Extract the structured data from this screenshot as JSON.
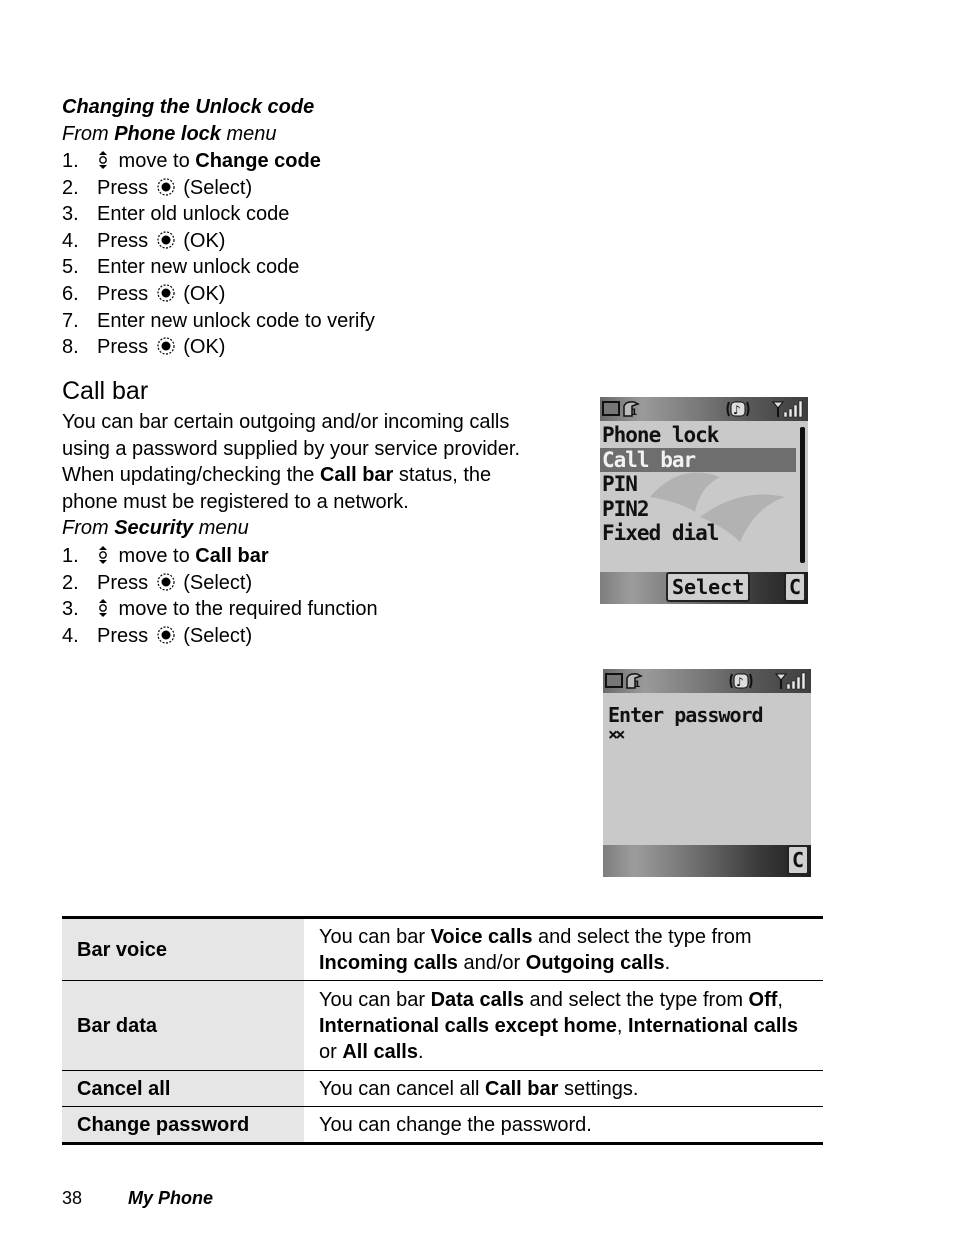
{
  "unlock_section": {
    "subheading": "Changing the Unlock code",
    "from_prefix": "From ",
    "from_menu": "Phone lock",
    "from_suffix": " menu",
    "steps": [
      {
        "num": "1.",
        "icon": "nav-key-icon",
        "pre": " move to ",
        "bold": "Change code",
        "post": ""
      },
      {
        "num": "2.",
        "icon": "select-key-icon",
        "pre": "Press ",
        "bold": "",
        "post": " (Select)"
      },
      {
        "num": "3.",
        "icon": "",
        "pre": "Enter old unlock code",
        "bold": "",
        "post": ""
      },
      {
        "num": "4.",
        "icon": "select-key-icon",
        "pre": "Press ",
        "bold": "",
        "post": " (OK)"
      },
      {
        "num": "5.",
        "icon": "",
        "pre": "Enter new unlock code",
        "bold": "",
        "post": ""
      },
      {
        "num": "6.",
        "icon": "select-key-icon",
        "pre": "Press ",
        "bold": "",
        "post": " (OK)"
      },
      {
        "num": "7.",
        "icon": "",
        "pre": "Enter new unlock code to verify",
        "bold": "",
        "post": ""
      },
      {
        "num": "8.",
        "icon": "select-key-icon",
        "pre": "Press ",
        "bold": "",
        "post": " (OK)"
      }
    ]
  },
  "callbar_section": {
    "heading": "Call bar",
    "intro_1": "You can bar certain outgoing and/or incoming calls",
    "intro_2": "using a password supplied by your service provider.",
    "intro_3_pre": "When updating/checking the ",
    "intro_3_bold": "Call bar",
    "intro_3_post": " status, the",
    "intro_4": "phone must be registered to a network.",
    "from_prefix": "From ",
    "from_menu": "Security",
    "from_suffix": " menu",
    "steps": [
      {
        "num": "1.",
        "icon": "nav-key-icon",
        "pre": " move to ",
        "bold": "Call bar",
        "post": ""
      },
      {
        "num": "2.",
        "icon": "select-key-icon",
        "pre": "Press ",
        "bold": "",
        "post": " (Select)"
      },
      {
        "num": "3.",
        "icon": "nav-key-icon",
        "pre": " move to the required function",
        "bold": "",
        "post": ""
      },
      {
        "num": "4.",
        "icon": "select-key-icon",
        "pre": "Press ",
        "bold": "",
        "post": " (Select)"
      }
    ]
  },
  "screen_menu": {
    "items": [
      "Phone lock",
      "Call bar",
      "PIN",
      "PIN2",
      "Fixed dial"
    ],
    "highlighted": "Call bar",
    "softkey_left": "Select",
    "softkey_right": "C"
  },
  "screen_password": {
    "prompt": "Enter password",
    "masked_value": "××",
    "softkey_right": "C"
  },
  "table": {
    "rows": [
      {
        "key": "Bar voice",
        "parts": [
          {
            "t": "You can bar ",
            "b": false
          },
          {
            "t": "Voice calls",
            "b": true
          },
          {
            "t": " and select the type from ",
            "b": false
          },
          {
            "t": "Incoming calls",
            "b": true
          },
          {
            "t": " and/or ",
            "b": false
          },
          {
            "t": "Outgoing calls",
            "b": true
          },
          {
            "t": ".",
            "b": false
          }
        ]
      },
      {
        "key": "Bar data",
        "parts": [
          {
            "t": "You can bar ",
            "b": false
          },
          {
            "t": "Data calls",
            "b": true
          },
          {
            "t": " and select the type from ",
            "b": false
          },
          {
            "t": "Off",
            "b": true
          },
          {
            "t": ", ",
            "b": false
          },
          {
            "t": "International calls except home",
            "b": true
          },
          {
            "t": ", ",
            "b": false
          },
          {
            "t": "International calls",
            "b": true
          },
          {
            "t": " or ",
            "b": false
          },
          {
            "t": "All calls",
            "b": true
          },
          {
            "t": ".",
            "b": false
          }
        ]
      },
      {
        "key": "Cancel all",
        "parts": [
          {
            "t": "You can cancel all ",
            "b": false
          },
          {
            "t": "Call bar",
            "b": true
          },
          {
            "t": " settings.",
            "b": false
          }
        ]
      },
      {
        "key": "Change password",
        "parts": [
          {
            "t": "You can change the password.",
            "b": false
          }
        ]
      }
    ]
  },
  "footer": {
    "page_number": "38",
    "chapter": "My Phone"
  }
}
